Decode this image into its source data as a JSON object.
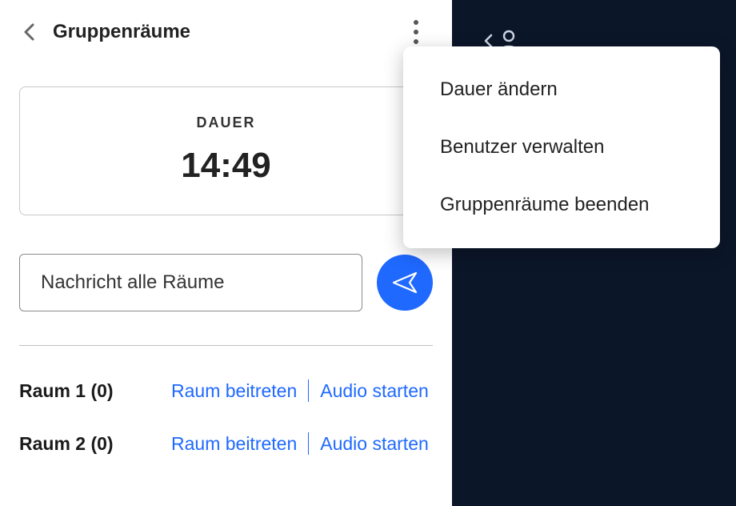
{
  "header": {
    "title": "Gruppenräume"
  },
  "duration": {
    "label": "DAUER",
    "time": "14:49"
  },
  "message": {
    "placeholder": "Nachricht alle Räume"
  },
  "rooms": [
    {
      "name": "Raum 1  (0)",
      "join": "Raum beitreten",
      "audio": "Audio starten"
    },
    {
      "name": "Raum 2  (0)",
      "join": "Raum beitreten",
      "audio": "Audio starten"
    }
  ],
  "menu": {
    "items": [
      "Dauer ändern",
      "Benutzer verwalten",
      "Gruppenräume beenden"
    ]
  }
}
